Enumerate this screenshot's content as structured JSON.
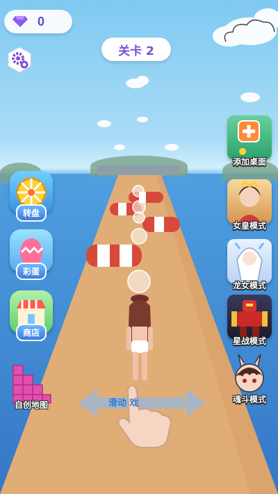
{
  "hud": {
    "gem_count": "0",
    "level_label": "关卡 2"
  },
  "left_menu": [
    {
      "label": "转盘",
      "icon": "wheel-icon"
    },
    {
      "label": "彩蛋",
      "icon": "egg-icon"
    },
    {
      "label": "商店",
      "icon": "shop-icon"
    },
    {
      "label": "自创地图",
      "icon": "map-blocks-icon"
    }
  ],
  "right_menu": [
    {
      "label": "添加桌面",
      "icon": "add-desktop-icon"
    },
    {
      "label": "女皇模式",
      "icon": "empress-icon"
    },
    {
      "label": "龙女模式",
      "icon": "dragon-girl-icon"
    },
    {
      "label": "星战模式",
      "icon": "robot-icon"
    },
    {
      "label": "魂斗模式",
      "icon": "bunny-boy-icon"
    }
  ],
  "hint": {
    "text": "滑动  戏"
  },
  "colors": {
    "level_text": "#7c4fd6",
    "gem": "#8a5cf0",
    "road": "#e3b07a",
    "obstacle_red": "#d64a3a"
  }
}
